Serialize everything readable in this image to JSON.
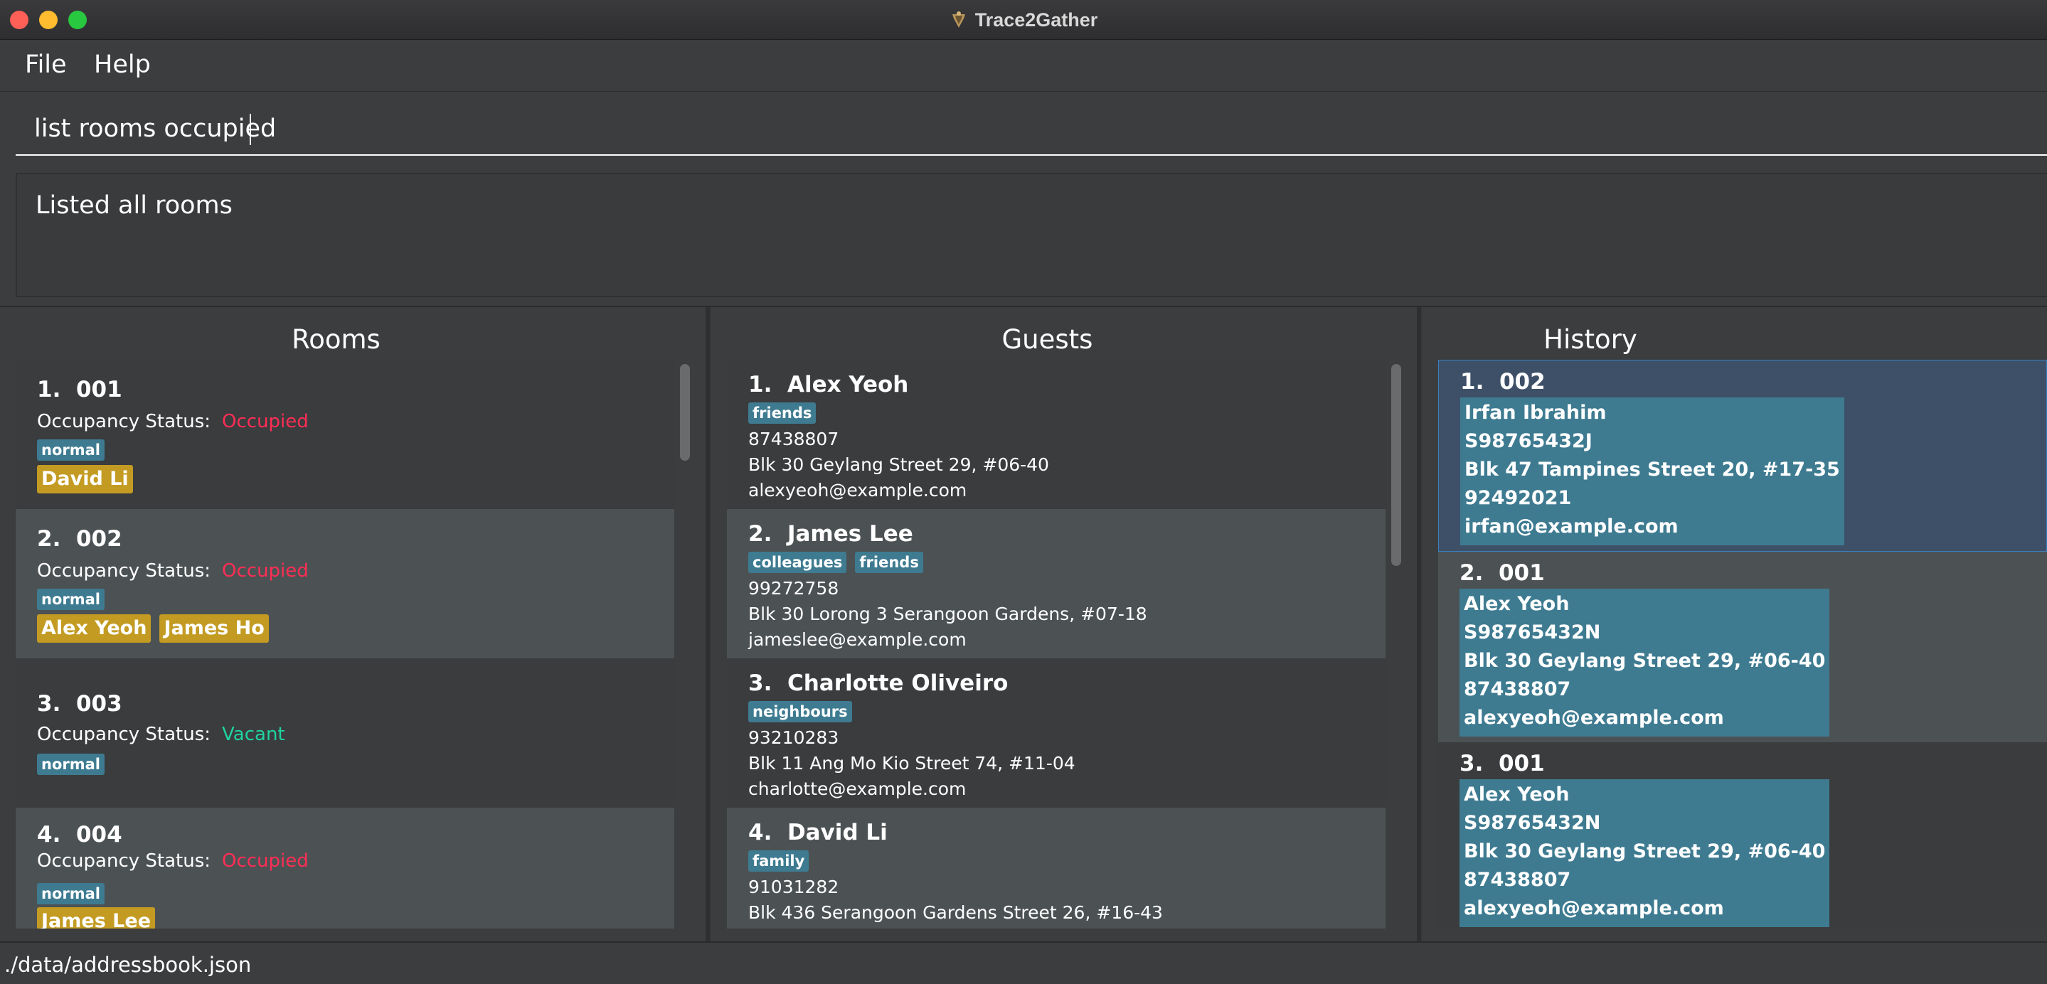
{
  "window": {
    "title": "Trace2Gather"
  },
  "menu": {
    "file": "File",
    "help": "Help"
  },
  "command": {
    "value": "list rooms occupied"
  },
  "result": {
    "text": "Listed all rooms"
  },
  "rooms_panel": {
    "title": "Rooms",
    "status_label": "Occupancy Status:",
    "items": [
      {
        "index": "1.",
        "number": "001",
        "status": "Occupied",
        "tag": "normal",
        "occupants": [
          "David Li"
        ]
      },
      {
        "index": "2.",
        "number": "002",
        "status": "Occupied",
        "tag": "normal",
        "occupants": [
          "Alex Yeoh",
          "James Ho"
        ]
      },
      {
        "index": "3.",
        "number": "003",
        "status": "Vacant",
        "tag": "normal",
        "occupants": []
      },
      {
        "index": "4.",
        "number": "004",
        "status": "Occupied",
        "tag": "normal",
        "occupants": [
          "James Lee"
        ]
      }
    ]
  },
  "guests_panel": {
    "title": "Guests",
    "items": [
      {
        "index": "1.",
        "name": "Alex Yeoh",
        "tags": [
          "friends"
        ],
        "phone": "87438807",
        "address": "Blk 30 Geylang Street 29, #06-40",
        "email": "alexyeoh@example.com"
      },
      {
        "index": "2.",
        "name": "James Lee",
        "tags": [
          "colleagues",
          "friends"
        ],
        "phone": "99272758",
        "address": "Blk 30 Lorong 3 Serangoon Gardens, #07-18",
        "email": "jameslee@example.com"
      },
      {
        "index": "3.",
        "name": "Charlotte Oliveiro",
        "tags": [
          "neighbours"
        ],
        "phone": "93210283",
        "address": "Blk 11 Ang Mo Kio Street 74, #11-04",
        "email": "charlotte@example.com"
      },
      {
        "index": "4.",
        "name": "David Li",
        "tags": [
          "family"
        ],
        "phone": "91031282",
        "address": "Blk 436 Serangoon Gardens Street 26, #16-43",
        "email": ""
      }
    ]
  },
  "history_panel": {
    "title": "History",
    "items": [
      {
        "index": "1.",
        "room": "002",
        "guest": {
          "name": "Irfan Ibrahim",
          "id": "S98765432J",
          "address": "Blk 47 Tampines Street 20, #17-35",
          "phone": "92492021",
          "email": "irfan@example.com"
        }
      },
      {
        "index": "2.",
        "room": "001",
        "guest": {
          "name": "Alex Yeoh",
          "id": "S98765432N",
          "address": "Blk 30 Geylang Street 29, #06-40",
          "phone": "87438807",
          "email": "alexyeoh@example.com"
        }
      },
      {
        "index": "3.",
        "room": "001",
        "guest": {
          "name": "Alex Yeoh",
          "id": "S98765432N",
          "address": "Blk 30 Geylang Street 29, #06-40",
          "phone": "87438807",
          "email": "alexyeoh@example.com"
        }
      }
    ]
  },
  "statusbar": {
    "path": "./data/addressbook.json"
  },
  "colors": {
    "occupied": "#ff2d55",
    "vacant": "#1fd3a0",
    "tag": "#3e7b91",
    "occupant_tag": "#c39b22",
    "selected_border": "#3b7fbf"
  },
  "icons": {
    "app": "trace2gather-app-icon"
  }
}
